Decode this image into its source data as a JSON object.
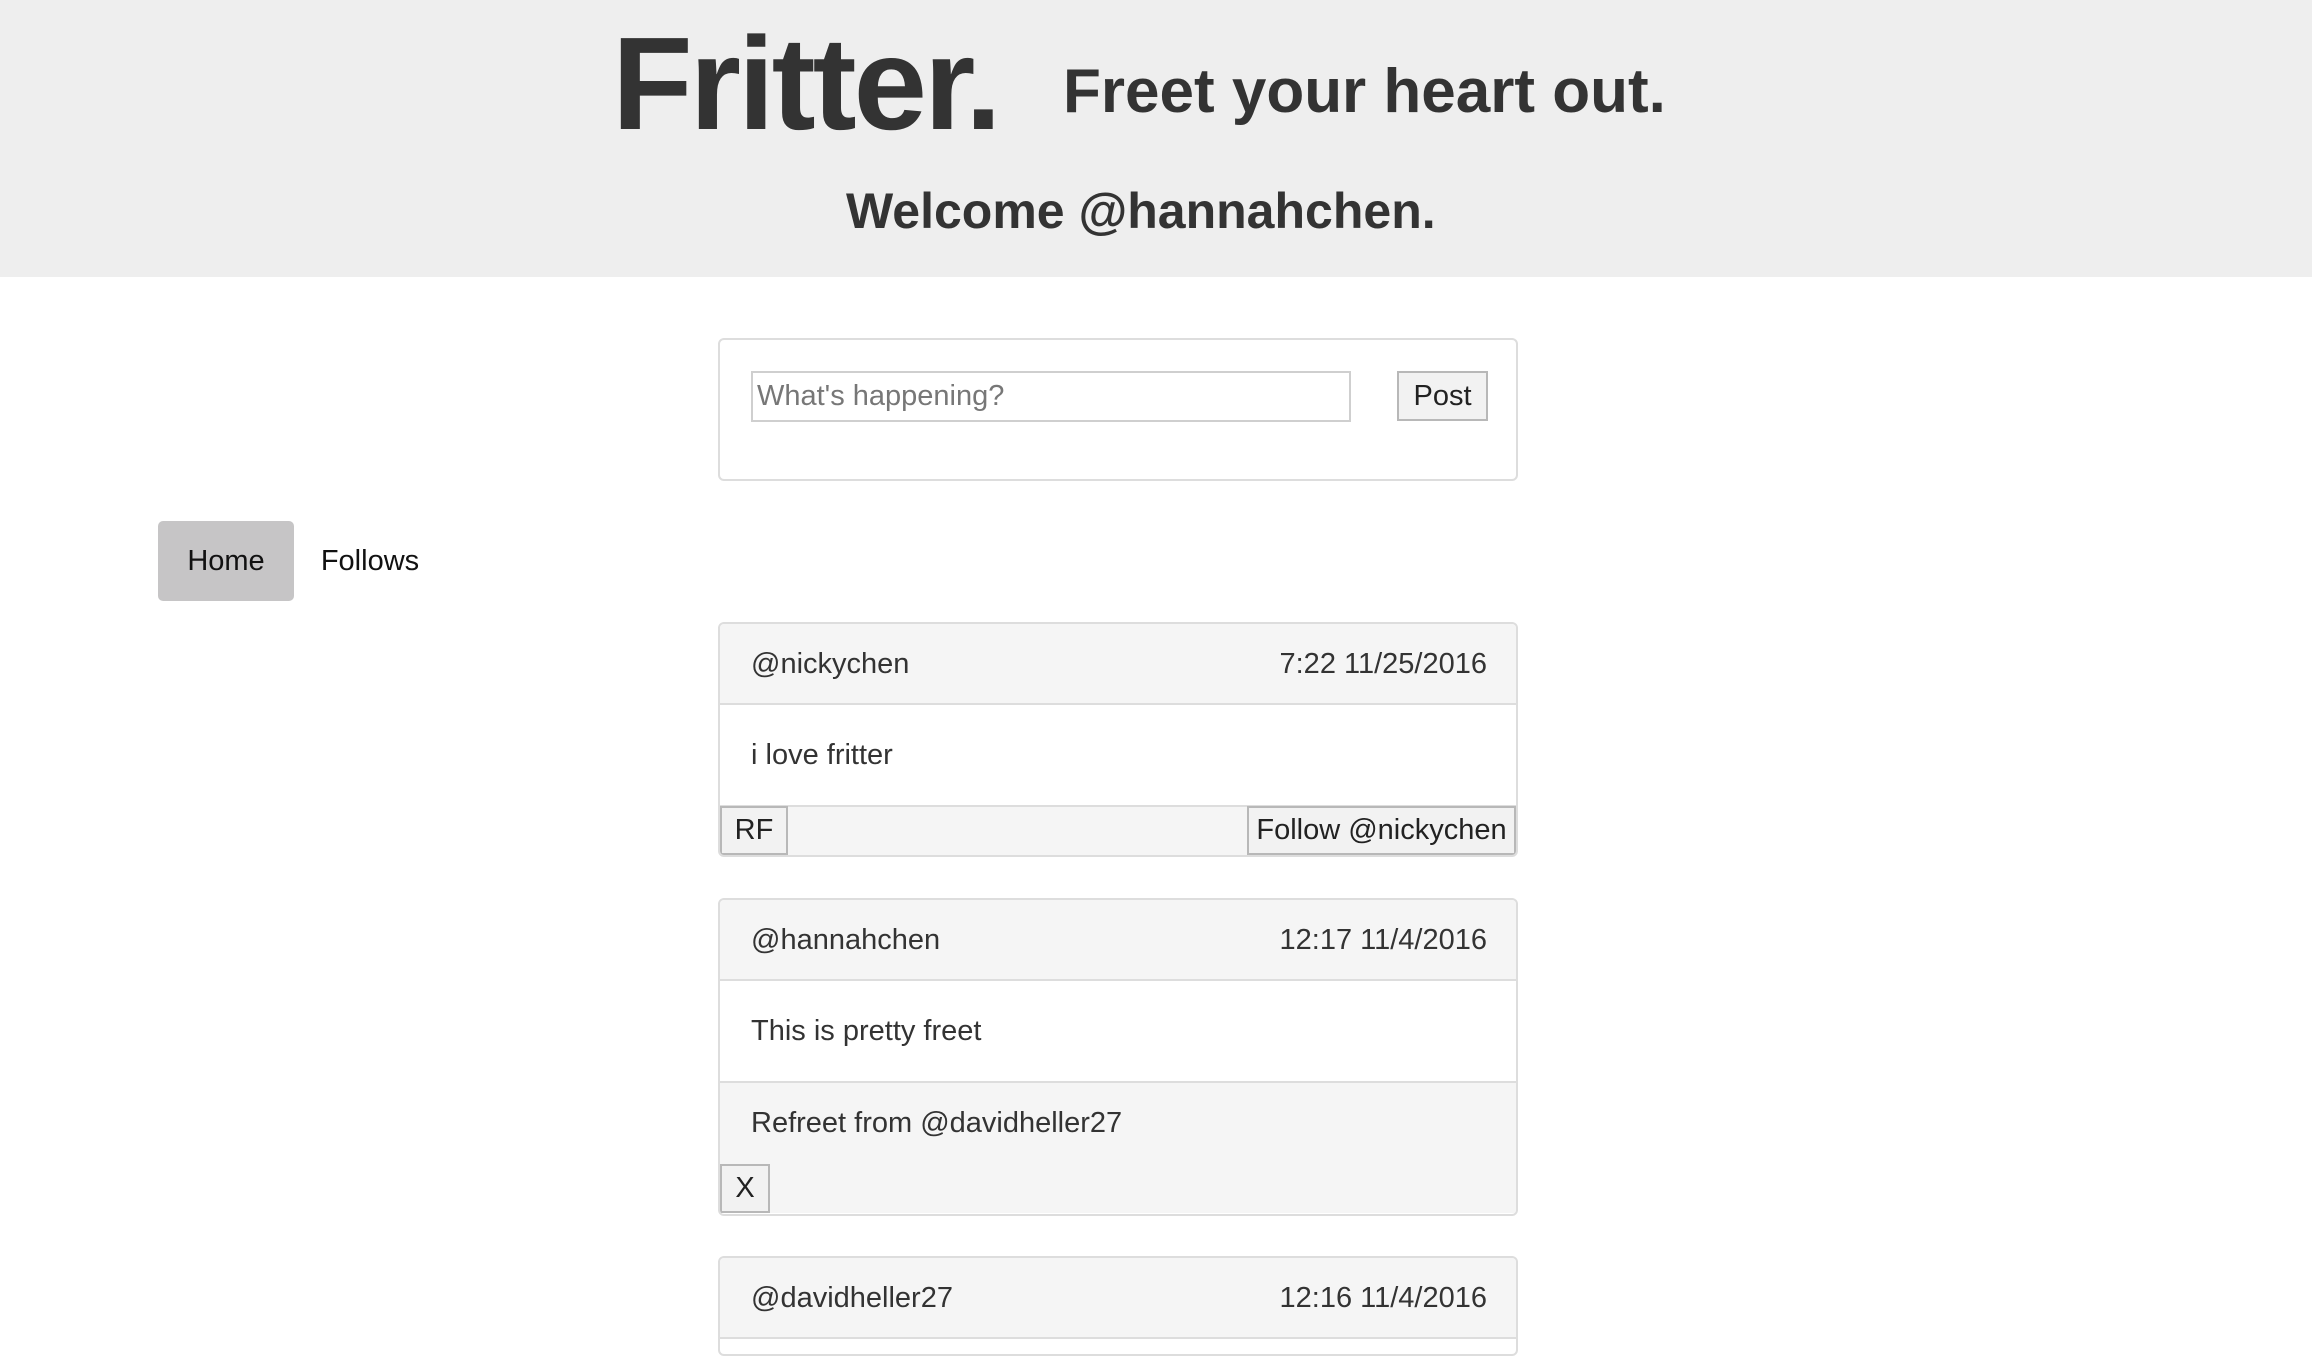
{
  "header": {
    "brand": "Fritter.",
    "tagline": "Freet your heart out.",
    "welcome": "Welcome @hannahchen."
  },
  "compose": {
    "placeholder": "What's happening?",
    "value": "",
    "post_label": "Post"
  },
  "nav": {
    "items": [
      {
        "label": "Home",
        "active": true
      },
      {
        "label": "Follows",
        "active": false
      }
    ]
  },
  "freets": [
    {
      "author": "@nickychen",
      "time": "7:22 11/25/2016",
      "text": "i love fritter",
      "refreet_label": "RF",
      "follow_label": "Follow @nickychen"
    },
    {
      "author": "@hannahchen",
      "time": "12:17 11/4/2016",
      "text": "This is pretty freet",
      "refreet_note": "Refreet from @davidheller27",
      "delete_label": "X"
    },
    {
      "author": "@davidheller27",
      "time": "12:16 11/4/2016"
    }
  ],
  "colors": {
    "header_bg": "#eeeeee",
    "active_pill_bg": "#c6c5c6",
    "card_header_bg": "#f5f5f5",
    "border": "#dddddd",
    "text": "#333333"
  }
}
